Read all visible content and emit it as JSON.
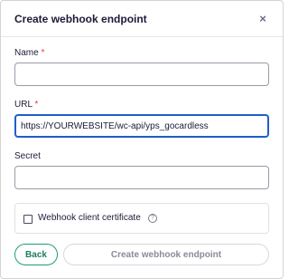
{
  "dialog": {
    "title": "Create webhook endpoint",
    "close_icon": "close-icon",
    "close_symbol": "×"
  },
  "fields": {
    "name": {
      "label": "Name",
      "required_mark": "*",
      "value": ""
    },
    "url": {
      "label": "URL",
      "required_mark": "*",
      "value": "https://YOURWEBSITE/wc-api/yps_gocardless"
    },
    "secret": {
      "label": "Secret",
      "value": ""
    }
  },
  "certificate": {
    "label": "Webhook client certificate",
    "checked": false,
    "help_icon": "help-circle-icon",
    "help_symbol": "?"
  },
  "buttons": {
    "back": "Back",
    "create": "Create webhook endpoint"
  },
  "colors": {
    "accent_focus": "#1f5fc8",
    "back_button": "#1f9e73",
    "required": "#e0453a"
  }
}
